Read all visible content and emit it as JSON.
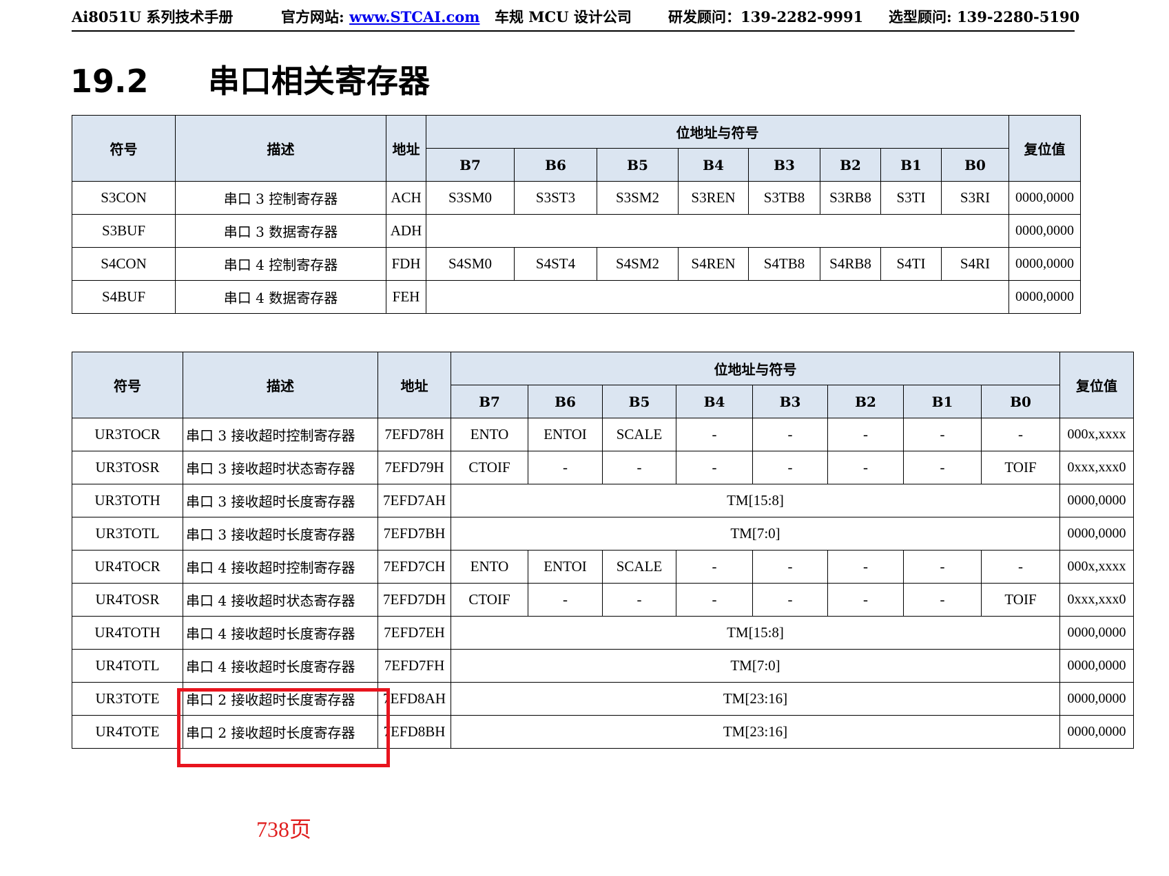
{
  "header": {
    "manual": "Ai8051U 系列技术手册",
    "site_label": "官方网站: ",
    "site_link": "www.STCAI.com",
    "company": "车规 MCU 设计公司",
    "rd_contact": "研发顾问：139-2282-9991",
    "sel_contact": "选型顾问: 139-2280-5190"
  },
  "section": {
    "number": "19.2",
    "title": "串口相关寄存器"
  },
  "table_headers": {
    "symbol": "符号",
    "description": "描述",
    "address": "地址",
    "bits_group": "位地址与符号",
    "reset": "复位值",
    "bits": [
      "B7",
      "B6",
      "B5",
      "B4",
      "B3",
      "B2",
      "B1",
      "B0"
    ]
  },
  "table1": {
    "rows": [
      {
        "symbol": "S3CON",
        "desc": "串口 3 控制寄存器",
        "addr": "ACH",
        "bits": [
          "S3SM0",
          "S3ST3",
          "S3SM2",
          "S3REN",
          "S3TB8",
          "S3RB8",
          "S3TI",
          "S3RI"
        ],
        "reset": "0000,0000"
      },
      {
        "symbol": "S3BUF",
        "desc": "串口 3 数据寄存器",
        "addr": "ADH",
        "span": "",
        "reset": "0000,0000"
      },
      {
        "symbol": "S4CON",
        "desc": "串口 4 控制寄存器",
        "addr": "FDH",
        "bits": [
          "S4SM0",
          "S4ST4",
          "S4SM2",
          "S4REN",
          "S4TB8",
          "S4RB8",
          "S4TI",
          "S4RI"
        ],
        "reset": "0000,0000"
      },
      {
        "symbol": "S4BUF",
        "desc": "串口 4 数据寄存器",
        "addr": "FEH",
        "span": "",
        "reset": "0000,0000"
      }
    ]
  },
  "table2": {
    "rows": [
      {
        "symbol": "UR3TOCR",
        "desc": "串口 3 接收超时控制寄存器",
        "addr": "7EFD78H",
        "bits": [
          "ENTO",
          "ENTOI",
          "SCALE",
          "-",
          "-",
          "-",
          "-",
          "-"
        ],
        "reset": "000x,xxxx"
      },
      {
        "symbol": "UR3TOSR",
        "desc": "串口 3 接收超时状态寄存器",
        "addr": "7EFD79H",
        "bits": [
          "CTOIF",
          "-",
          "-",
          "-",
          "-",
          "-",
          "-",
          "TOIF"
        ],
        "reset": "0xxx,xxx0"
      },
      {
        "symbol": "UR3TOTH",
        "desc": "串口 3 接收超时长度寄存器",
        "addr": "7EFD7AH",
        "span": "TM[15:8]",
        "reset": "0000,0000"
      },
      {
        "symbol": "UR3TOTL",
        "desc": "串口 3 接收超时长度寄存器",
        "addr": "7EFD7BH",
        "span": "TM[7:0]",
        "reset": "0000,0000"
      },
      {
        "symbol": "UR4TOCR",
        "desc": "串口 4 接收超时控制寄存器",
        "addr": "7EFD7CH",
        "bits": [
          "ENTO",
          "ENTOI",
          "SCALE",
          "-",
          "-",
          "-",
          "-",
          "-"
        ],
        "reset": "000x,xxxx"
      },
      {
        "symbol": "UR4TOSR",
        "desc": "串口 4 接收超时状态寄存器",
        "addr": "7EFD7DH",
        "bits": [
          "CTOIF",
          "-",
          "-",
          "-",
          "-",
          "-",
          "-",
          "TOIF"
        ],
        "reset": "0xxx,xxx0"
      },
      {
        "symbol": "UR4TOTH",
        "desc": "串口 4 接收超时长度寄存器",
        "addr": "7EFD7EH",
        "span": "TM[15:8]",
        "reset": "0000,0000"
      },
      {
        "symbol": "UR4TOTL",
        "desc": "串口 4 接收超时长度寄存器",
        "addr": "7EFD7FH",
        "span": "TM[7:0]",
        "reset": "0000,0000"
      },
      {
        "symbol": "UR3TOTE",
        "desc": "串口 2 接收超时长度寄存器",
        "addr": "7EFD8AH",
        "span": "TM[23:16]",
        "reset": "0000,0000"
      },
      {
        "symbol": "UR4TOTE",
        "desc": "串口 2 接收超时长度寄存器",
        "addr": "7EFD8BH",
        "span": "TM[23:16]",
        "reset": "0000,0000"
      }
    ]
  },
  "annotation": {
    "page_note": "738页",
    "highlight_color": "#e8141e"
  },
  "colors": {
    "header_fill": "#dbe5f1",
    "link": "#0000ee",
    "note": "#e02020"
  }
}
